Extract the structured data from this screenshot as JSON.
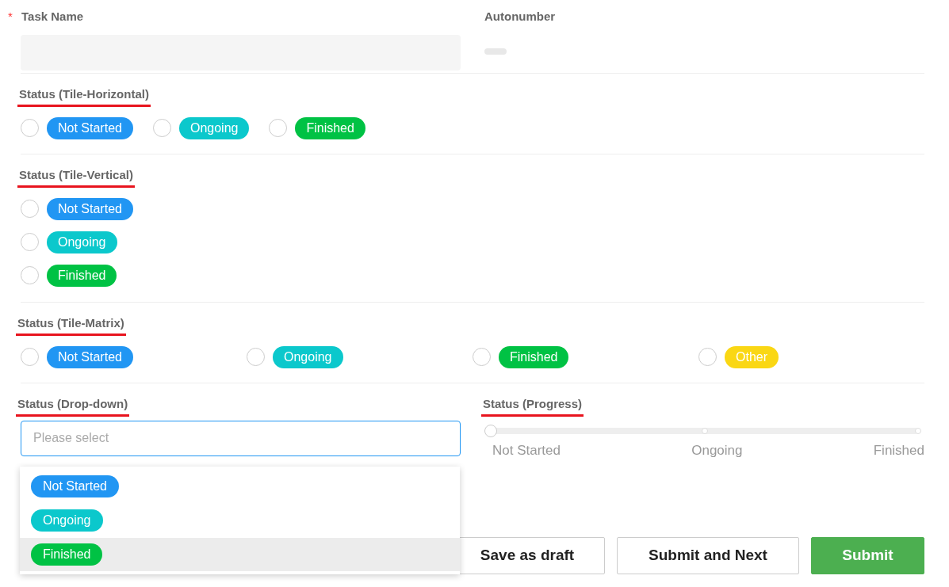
{
  "task_name": {
    "label": "Task Name",
    "required_mark": "*"
  },
  "autonumber": {
    "label": "Autonumber"
  },
  "status_horizontal": {
    "label": "Status (Tile-Horizontal)",
    "options": [
      {
        "label": "Not Started",
        "color": "#2196f3",
        "selected": false
      },
      {
        "label": "Ongoing",
        "color": "#0bc8cc",
        "selected": false
      },
      {
        "label": "Finished",
        "color": "#00c244",
        "selected": false
      }
    ]
  },
  "status_vertical": {
    "label": "Status (Tile-Vertical)",
    "options": [
      {
        "label": "Not Started",
        "color": "#2196f3",
        "selected": false
      },
      {
        "label": "Ongoing",
        "color": "#0bc8cc",
        "selected": false
      },
      {
        "label": "Finished",
        "color": "#00c244",
        "selected": false
      }
    ]
  },
  "status_matrix": {
    "label": "Status (Tile-Matrix)",
    "options": [
      {
        "label": "Not Started",
        "color": "#2196f3",
        "selected": false
      },
      {
        "label": "Ongoing",
        "color": "#0bc8cc",
        "selected": false
      },
      {
        "label": "Finished",
        "color": "#00c244",
        "selected": false
      },
      {
        "label": "Other",
        "color": "#fad714",
        "selected": false
      }
    ]
  },
  "status_dropdown": {
    "label": "Status (Drop-down)",
    "placeholder": "Please select",
    "expanded": true,
    "options": [
      {
        "label": "Not Started",
        "color": "#2196f3",
        "highlighted": false
      },
      {
        "label": "Ongoing",
        "color": "#0bc8cc",
        "highlighted": false
      },
      {
        "label": "Finished",
        "color": "#00c244",
        "highlighted": true
      }
    ]
  },
  "status_progress": {
    "label": "Status (Progress)",
    "level": 0,
    "stops": [
      "Not Started",
      "Ongoing",
      "Finished"
    ]
  },
  "buttons": [
    {
      "label": "Save as draft",
      "kind": "secondary"
    },
    {
      "label": "Submit and Next",
      "kind": "secondary"
    },
    {
      "label": "Submit",
      "kind": "primary"
    }
  ]
}
